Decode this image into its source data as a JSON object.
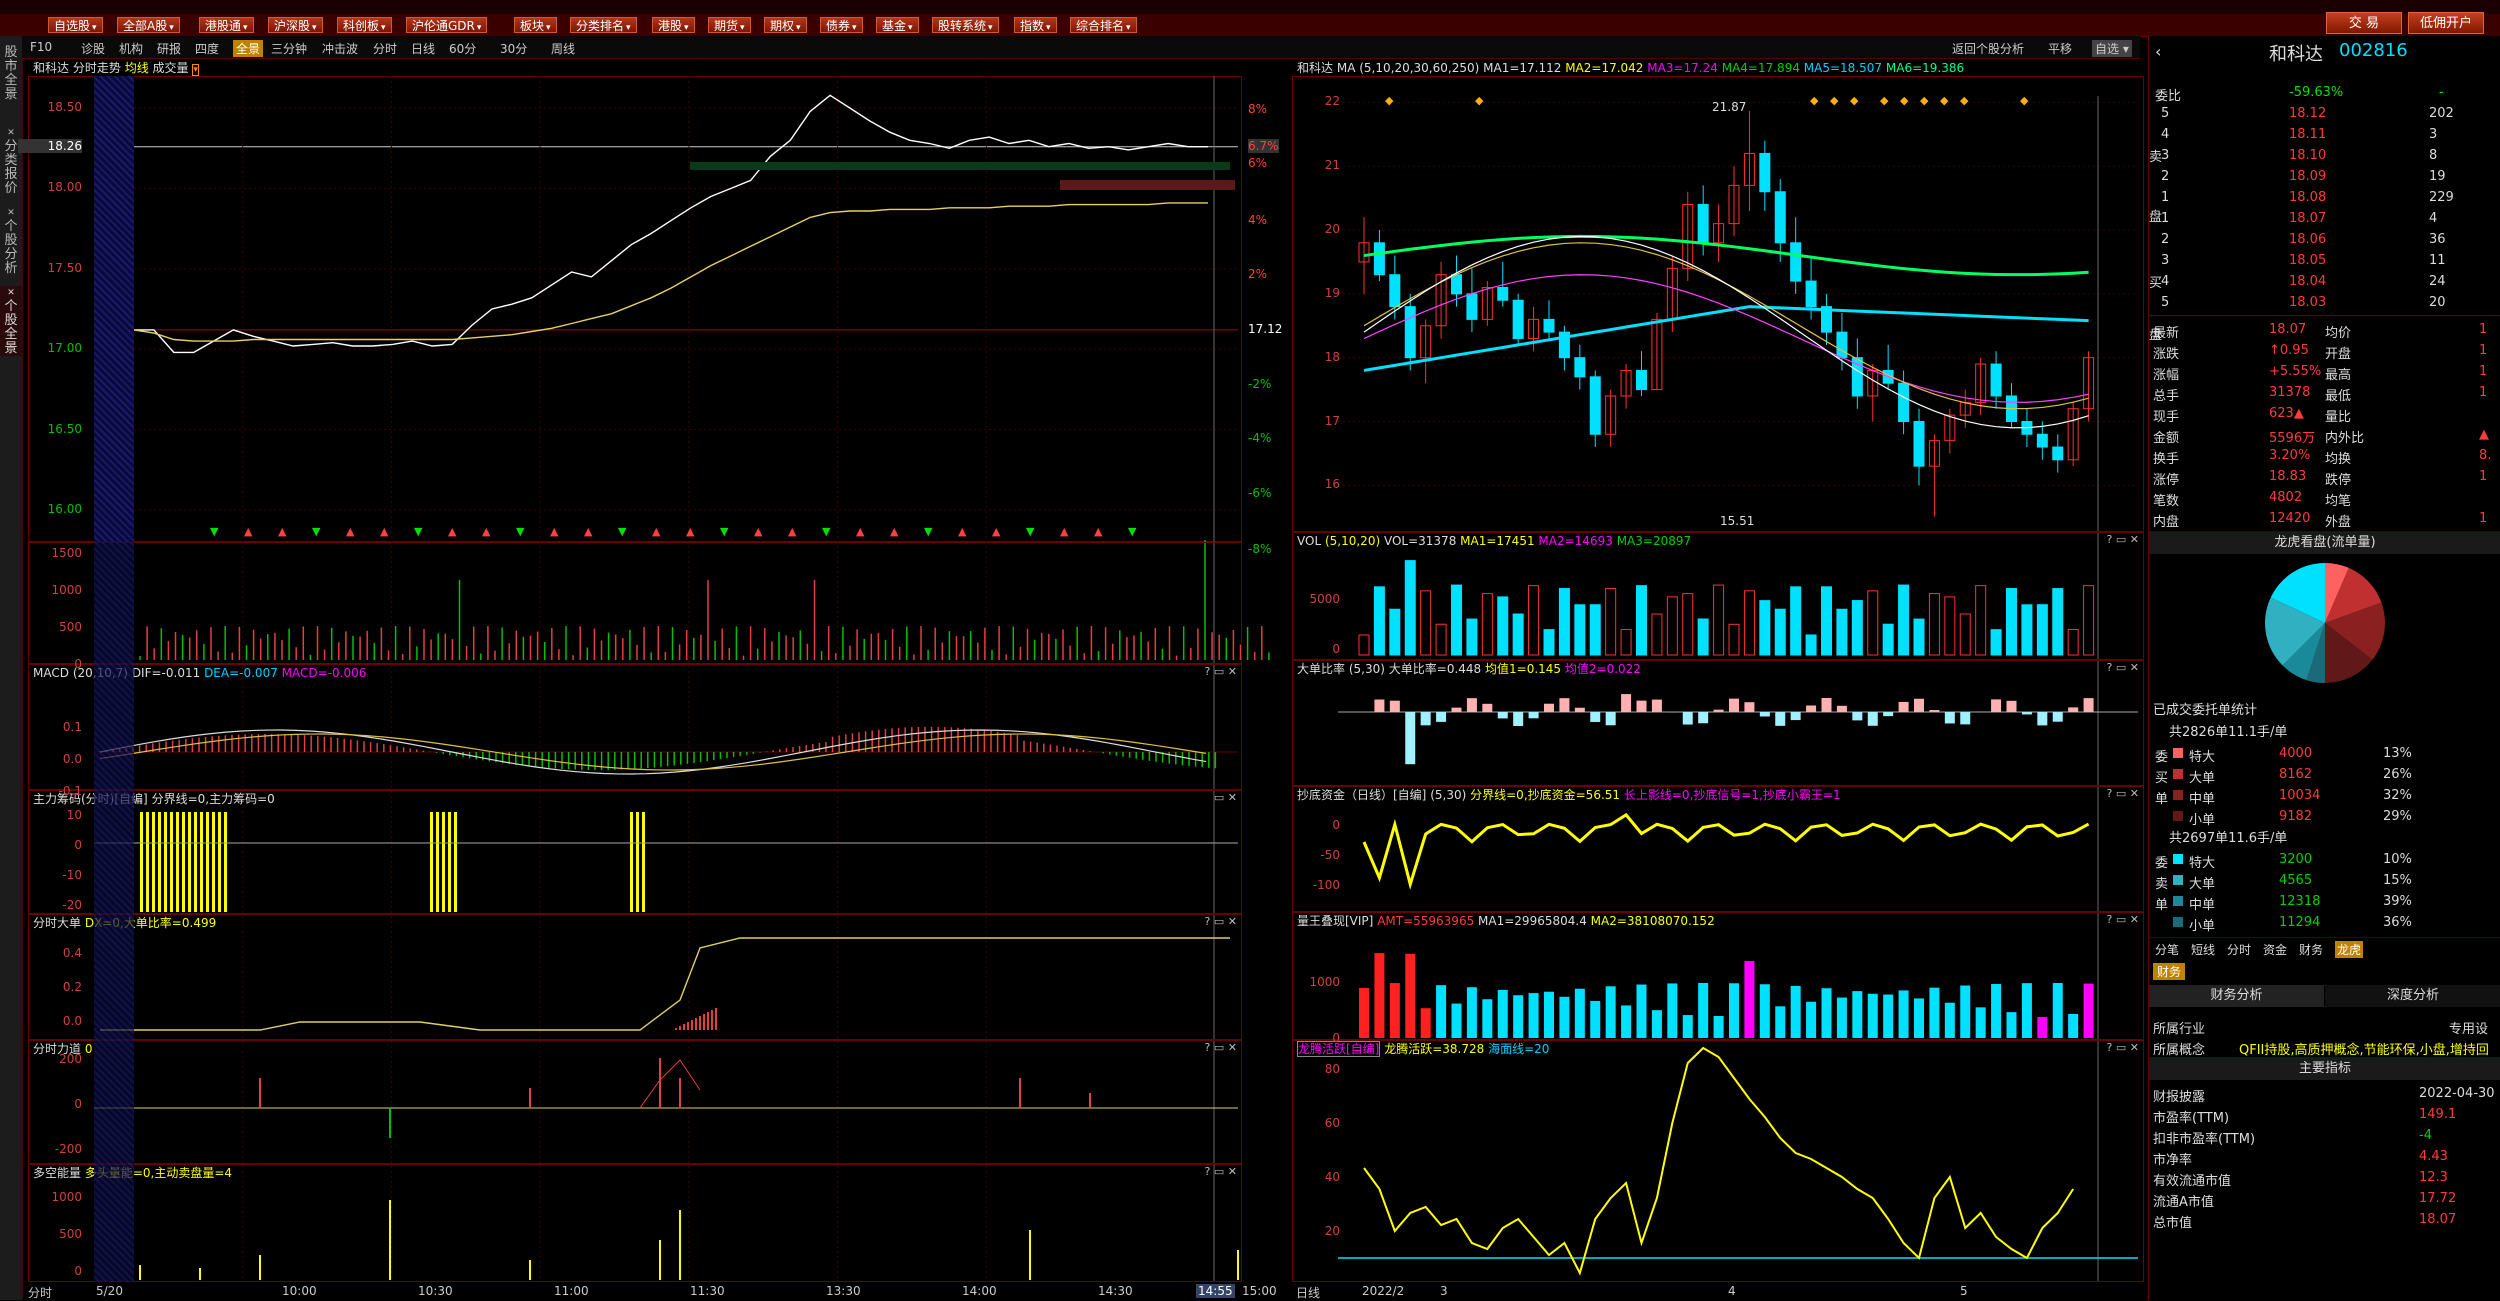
{
  "menubar": {
    "items": [
      "自选股",
      "全部A股",
      "港股通",
      "沪深股",
      "科创板",
      "沪伦通GDR",
      "板块",
      "分类排名",
      "港股",
      "期货",
      "期权",
      "债券",
      "基金",
      "股转系统",
      "指数",
      "综合排名"
    ],
    "trade_buttons": [
      "交 易",
      "低佣开户"
    ]
  },
  "leftbar": {
    "tabs": [
      "股市全景",
      "分类报价",
      "个股分析",
      "个股全景"
    ]
  },
  "toolbar": {
    "left_items": [
      "F10",
      "诊股",
      "机构",
      "研报",
      "四度",
      "全景",
      "三分钟",
      "冲击波",
      "分时",
      "日线",
      "60分",
      "30分",
      "周线"
    ],
    "selected": "全景",
    "right_items": [
      "返回个股分析",
      "平移",
      "自选"
    ]
  },
  "intraday": {
    "stock_name": "和科达",
    "title": "分时走势",
    "avg_line": "均线",
    "vol_label": "成交量",
    "price_ticks": [
      "18.50",
      "18.26",
      "18.00",
      "17.50",
      "17.00",
      "16.50",
      "16.00"
    ],
    "pct_ticks": [
      "8%",
      "6.7%",
      "6%",
      "4%",
      "2%",
      "17.12",
      "-2%",
      "-4%",
      "-6%",
      "-8%"
    ],
    "prev_close": "17.12",
    "current_price": "18.26",
    "current_pct": "6.7%",
    "time_ticks": [
      "分时",
      "5/20",
      "10:00",
      "10:30",
      "11:00",
      "11:30",
      "13:30",
      "14:00",
      "14:30",
      "14:55",
      "15:00"
    ],
    "chart_data": {
      "type": "line",
      "series": [
        {
          "values": [
            17.12,
            17.12,
            16.98,
            16.98,
            17.05,
            17.12,
            17.08,
            17.05,
            17.02,
            17.03,
            17.04,
            17.02,
            17.02,
            17.03,
            17.05,
            17.02,
            17.03,
            17.15,
            17.25,
            17.28,
            17.32,
            17.4,
            17.48,
            17.45,
            17.55,
            17.65,
            17.72,
            17.8,
            17.88,
            17.95,
            18.0,
            18.05,
            18.2,
            18.3,
            18.48,
            18.58,
            18.5,
            18.42,
            18.35,
            18.3,
            18.28,
            18.25,
            18.3,
            18.32,
            18.28,
            18.3,
            18.26,
            18.28,
            18.25,
            18.26,
            18.24,
            18.26,
            18.28,
            18.26,
            18.26
          ]
        },
        {
          "values": [
            17.12,
            17.1,
            17.06,
            17.05,
            17.05,
            17.05,
            17.06,
            17.06,
            17.06,
            17.06,
            17.06,
            17.06,
            17.06,
            17.06,
            17.06,
            17.06,
            17.06,
            17.07,
            17.08,
            17.09,
            17.11,
            17.13,
            17.16,
            17.19,
            17.22,
            17.27,
            17.32,
            17.38,
            17.45,
            17.52,
            17.58,
            17.64,
            17.7,
            17.76,
            17.82,
            17.85,
            17.86,
            17.86,
            17.87,
            17.87,
            17.87,
            17.88,
            17.88,
            17.88,
            17.89,
            17.89,
            17.89,
            17.9,
            17.9,
            17.9,
            17.9,
            17.9,
            17.91,
            17.91,
            17.91
          ]
        }
      ],
      "ylim": [
        15.8,
        18.7
      ]
    }
  },
  "volume_panel": {
    "ticks": [
      "1500",
      "1000",
      "500",
      "0"
    ]
  },
  "macd_panel": {
    "title": "MACD",
    "params": "(20,10,7)",
    "dif": "DIF=-0.011",
    "dea": "DEA=-0.007",
    "macd": "MACD=-0.006",
    "ticks": [
      "0.1",
      "0.0",
      "-0.1"
    ]
  },
  "chip_panel": {
    "title": "主力筹码(分时)[自编]",
    "line": "分界线=0,主力筹码=0",
    "ticks": [
      "10",
      "0",
      "-10",
      "-20"
    ]
  },
  "bigorder_panel": {
    "title": "分时大单",
    "line": "DX=0,大单比率=0.499",
    "ticks": [
      "0.4",
      "0.2",
      "0.0"
    ]
  },
  "force_panel": {
    "title": "分时力道",
    "line": "0",
    "ticks": [
      "200",
      "0",
      "-200"
    ]
  },
  "energy_panel": {
    "title": "多空能量",
    "line": "多头量能=0,主动卖盘量=4",
    "ticks": [
      "1000",
      "500",
      "0"
    ]
  },
  "daily": {
    "stock_name": "和科达",
    "ma_title": "MA",
    "ma_params": "(5,10,20,30,60,250)",
    "ma_values": [
      "MA1=17.112",
      "MA2=17.042",
      "MA3=17.24",
      "MA4=17.894",
      "MA5=18.507",
      "MA6=19.386"
    ],
    "price_ticks": [
      "22",
      "21",
      "20",
      "19",
      "18",
      "17",
      "16"
    ],
    "high_label": "21.87",
    "low_label": "15.51",
    "date_ticks": [
      "日线",
      "2022/2",
      "3",
      "4",
      "5"
    ],
    "chart_data": {
      "type": "candlestick",
      "ohlc": [
        [
          19.5,
          20.2,
          19.0,
          19.8
        ],
        [
          19.8,
          20.0,
          19.2,
          19.3
        ],
        [
          19.3,
          19.6,
          18.6,
          18.8
        ],
        [
          18.8,
          19.0,
          17.8,
          18.0
        ],
        [
          18.0,
          18.6,
          17.6,
          18.5
        ],
        [
          18.5,
          19.5,
          18.3,
          19.3
        ],
        [
          19.3,
          19.6,
          18.8,
          19.0
        ],
        [
          19.0,
          19.4,
          18.4,
          18.6
        ],
        [
          18.6,
          19.2,
          18.5,
          19.1
        ],
        [
          19.1,
          19.5,
          18.8,
          18.9
        ],
        [
          18.9,
          19.0,
          18.2,
          18.3
        ],
        [
          18.3,
          18.8,
          18.1,
          18.6
        ],
        [
          18.6,
          18.9,
          18.3,
          18.4
        ],
        [
          18.4,
          18.5,
          17.8,
          18.0
        ],
        [
          18.0,
          18.2,
          17.5,
          17.7
        ],
        [
          17.7,
          17.8,
          16.6,
          16.8
        ],
        [
          16.8,
          17.5,
          16.6,
          17.4
        ],
        [
          17.4,
          17.9,
          17.2,
          17.8
        ],
        [
          17.8,
          18.1,
          17.4,
          17.5
        ],
        [
          17.5,
          18.7,
          17.5,
          18.6
        ],
        [
          18.6,
          19.6,
          18.4,
          19.4
        ],
        [
          19.4,
          20.6,
          19.2,
          20.4
        ],
        [
          20.4,
          20.7,
          19.6,
          19.8
        ],
        [
          19.8,
          20.4,
          19.5,
          20.1
        ],
        [
          20.1,
          21.0,
          19.9,
          20.7
        ],
        [
          20.7,
          21.87,
          20.3,
          21.2
        ],
        [
          21.2,
          21.4,
          20.3,
          20.6
        ],
        [
          20.6,
          20.8,
          19.5,
          19.8
        ],
        [
          19.8,
          20.2,
          19.0,
          19.2
        ],
        [
          19.2,
          19.6,
          18.6,
          18.8
        ],
        [
          18.8,
          19.0,
          18.2,
          18.4
        ],
        [
          18.4,
          18.7,
          17.8,
          18.0
        ],
        [
          18.0,
          18.3,
          17.2,
          17.4
        ],
        [
          17.4,
          17.9,
          17.0,
          17.8
        ],
        [
          17.8,
          18.2,
          17.5,
          17.6
        ],
        [
          17.6,
          17.8,
          16.8,
          17.0
        ],
        [
          17.0,
          17.2,
          16.0,
          16.3
        ],
        [
          16.3,
          16.8,
          15.51,
          16.7
        ],
        [
          16.7,
          17.2,
          16.5,
          17.1
        ],
        [
          17.1,
          17.5,
          16.9,
          17.3
        ],
        [
          17.3,
          18.0,
          17.1,
          17.9
        ],
        [
          17.9,
          18.1,
          17.2,
          17.4
        ],
        [
          17.4,
          17.6,
          16.9,
          17.0
        ],
        [
          17.0,
          17.2,
          16.6,
          16.8
        ],
        [
          16.8,
          17.0,
          16.4,
          16.6
        ],
        [
          16.6,
          16.8,
          16.2,
          16.4
        ],
        [
          16.4,
          17.3,
          16.3,
          17.2
        ],
        [
          17.2,
          18.1,
          17.0,
          18.0
        ]
      ],
      "ylim": [
        15.3,
        22.1
      ]
    }
  },
  "vol_daily": {
    "title": "VOL",
    "params": "(5,10,20)",
    "line": "VOL=31378",
    "ma1": "MA1=17451",
    "ma2": "MA2=14693",
    "ma3": "MA3=20897",
    "ticks": [
      "5000",
      "0"
    ]
  },
  "bigratio_daily": {
    "title": "大单比率",
    "params": "(5,30)",
    "line": "大单比率=0.448",
    "avg1": "均值1=0.145",
    "avg2": "均值2=0.022"
  },
  "bottomfish_daily": {
    "title": "抄底资金（日线）[自编]",
    "params": "(5,30)",
    "line": "分界线=0,抄底资金=56.51",
    "extra": "长上影线=0,抄底信号=1,抄底小霸王=1",
    "ticks": [
      "0",
      "-50",
      "-100"
    ]
  },
  "kingvol_daily": {
    "title": "量王叠现[VIP]",
    "amt": "AMT=55963965",
    "ma1": "MA1=29965804.4",
    "ma2": "MA2=38108070.152",
    "ticks": [
      "1000",
      "0"
    ]
  },
  "dragon_daily": {
    "title": "龙腾活跃[自编]",
    "line": "龙腾活跃=38.728",
    "sea": "海面线=20",
    "ticks": [
      "80",
      "60",
      "40",
      "20"
    ]
  },
  "right": {
    "stock_name": "和科达",
    "code": "002816",
    "weibi_label": "委比",
    "weibi_value": "-59.63%",
    "weibi_right": "-",
    "sell_rows": [
      [
        "5",
        "18.12",
        "202"
      ],
      [
        "4",
        "18.11",
        "3"
      ],
      [
        "3",
        "18.10",
        "8"
      ],
      [
        "2",
        "18.09",
        "19"
      ],
      [
        "1",
        "18.08",
        "229"
      ]
    ],
    "buy_rows": [
      [
        "1",
        "18.07",
        "4"
      ],
      [
        "2",
        "18.06",
        "36"
      ],
      [
        "3",
        "18.05",
        "11"
      ],
      [
        "4",
        "18.04",
        "24"
      ],
      [
        "5",
        "18.03",
        "20"
      ]
    ],
    "stats": [
      [
        "最新",
        "18.07",
        "均价",
        "1"
      ],
      [
        "涨跌",
        "↑0.95",
        "开盘",
        "1"
      ],
      [
        "涨幅",
        "+5.55%",
        "最高",
        "1"
      ],
      [
        "总手",
        "31378",
        "最低",
        "1"
      ],
      [
        "现手",
        "623▲",
        "量比",
        ""
      ],
      [
        "金额",
        "5596万",
        "内外比",
        "▲"
      ],
      [
        "换手",
        "3.20%",
        "均换",
        "8."
      ],
      [
        "涨停",
        "18.83",
        "跌停",
        "1"
      ],
      [
        "笔数",
        "4802",
        "均笔",
        ""
      ],
      [
        "内盘",
        "12420",
        "外盘",
        "1"
      ]
    ],
    "pie_title": "龙虎看盘(流单量)",
    "entrust_title": "已成交委托单统计",
    "buy_total": "共2826单11.1手/单",
    "buy_rows2": [
      [
        "特大",
        "4000",
        "13%"
      ],
      [
        "大单",
        "8162",
        "26%"
      ],
      [
        "中单",
        "10034",
        "32%"
      ],
      [
        "小单",
        "9182",
        "29%"
      ]
    ],
    "sell_total": "共2697单11.6手/单",
    "sell_rows2": [
      [
        "特大",
        "3200",
        "10%"
      ],
      [
        "大单",
        "4565",
        "15%"
      ],
      [
        "中单",
        "12318",
        "39%"
      ],
      [
        "小单",
        "11294",
        "36%"
      ]
    ],
    "side_buy": [
      "委",
      "买",
      "单"
    ],
    "side_sell": [
      "委",
      "卖",
      "单"
    ],
    "bottom_tabs": [
      "分笔",
      "短线",
      "分时",
      "资金",
      "财务",
      "龙虎"
    ],
    "finance_tab": "财务",
    "finance_sub": [
      "财务分析",
      "深度分析"
    ],
    "industry_label": "所属行业",
    "industry_value": "专用设",
    "concept_label": "所属概念",
    "concept_value": "QFII持股,高质押概念,节能环保,小盘,增持回",
    "main_index": "主要指标",
    "fin_rows": [
      [
        "财报披露",
        "2022-04-30"
      ],
      [
        "市盈率(TTM)",
        "149.1"
      ],
      [
        "扣非市盈率(TTM)",
        "-4"
      ],
      [
        "市净率",
        "4.43"
      ],
      [
        "有效流通市值",
        "12.3"
      ],
      [
        "流通A市值",
        "17.72"
      ],
      [
        "总市值",
        "18.07"
      ]
    ],
    "trade_side_labels": [
      "卖",
      "盘",
      "买",
      "盘"
    ]
  }
}
